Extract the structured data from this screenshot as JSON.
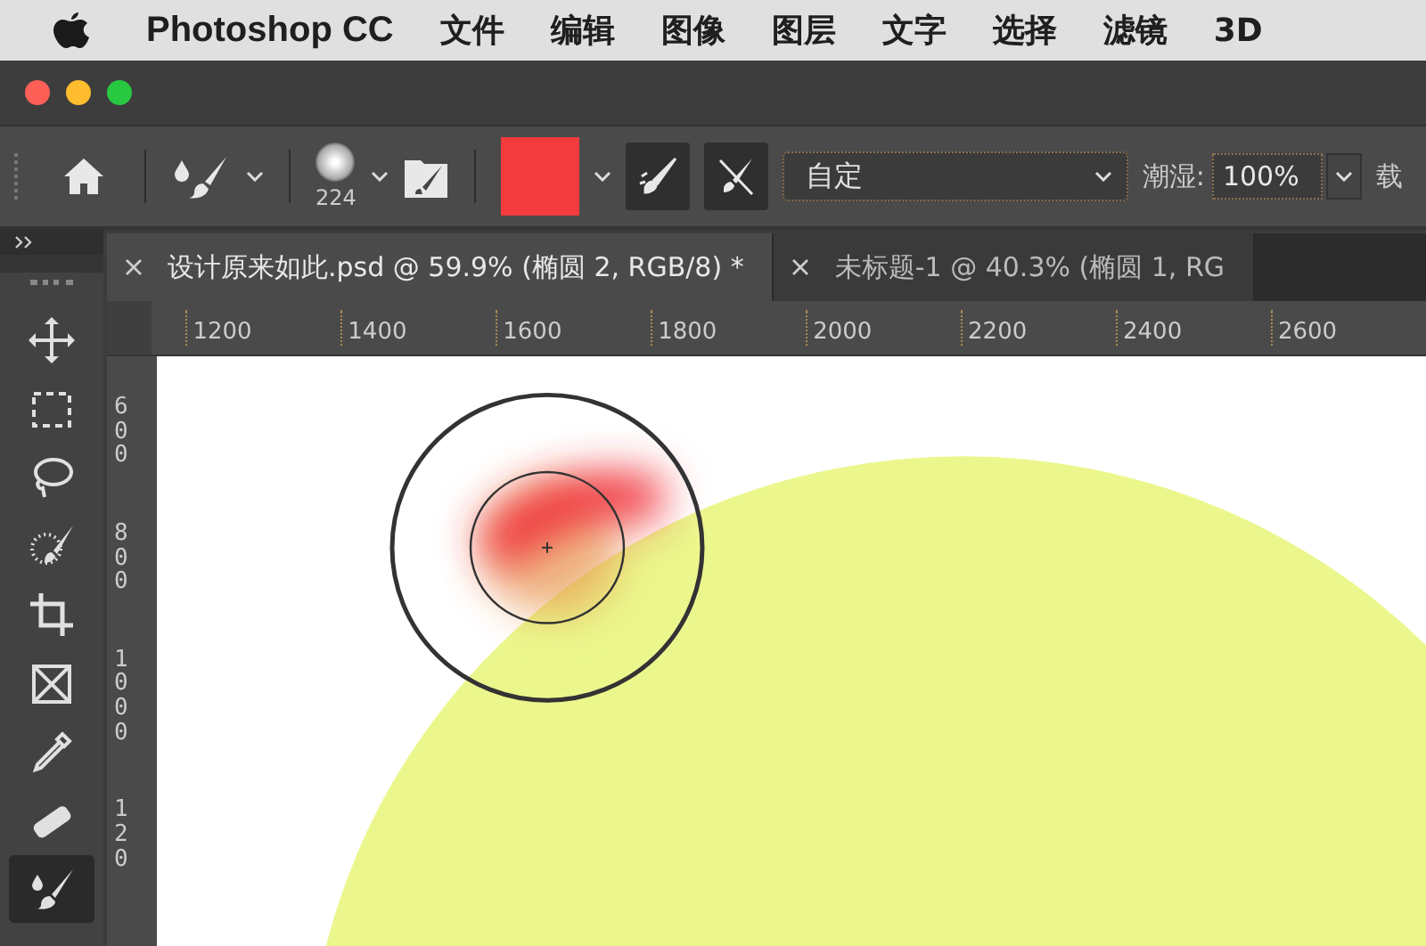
{
  "menu_bar": {
    "app_name": "Photoshop CC",
    "items": [
      "文件",
      "编辑",
      "图像",
      "图层",
      "文字",
      "选择",
      "滤镜",
      "3D"
    ]
  },
  "options_bar": {
    "brush_size": "224",
    "color": "#f33b3d",
    "airbrush": {
      "on": true
    },
    "mode": {
      "value": "自定"
    },
    "wet_label": "潮湿:",
    "wet_value": "100%",
    "cut_label": "载"
  },
  "tabs": [
    {
      "label": "设计原来如此.psd @ 59.9% (椭圆 2, RGB/8) *",
      "selected": true
    },
    {
      "label": "未标题-1 @ 40.3% (椭圆 1, RG",
      "selected": false
    }
  ],
  "tools": [
    {
      "kind": "move",
      "selected": false
    },
    {
      "kind": "marquee",
      "selected": false
    },
    {
      "kind": "lasso",
      "selected": false
    },
    {
      "kind": "quick-select",
      "selected": false
    },
    {
      "kind": "crop",
      "selected": false
    },
    {
      "kind": "frame",
      "selected": false
    },
    {
      "kind": "eyedropper",
      "selected": false
    },
    {
      "kind": "healing",
      "selected": false
    },
    {
      "kind": "brush",
      "selected": true
    }
  ],
  "ruler_h": [
    "1200",
    "1400",
    "1600",
    "1800",
    "2000",
    "2200",
    "2400",
    "2600"
  ],
  "ruler_v": [
    "600",
    "800",
    "1000",
    "120"
  ]
}
